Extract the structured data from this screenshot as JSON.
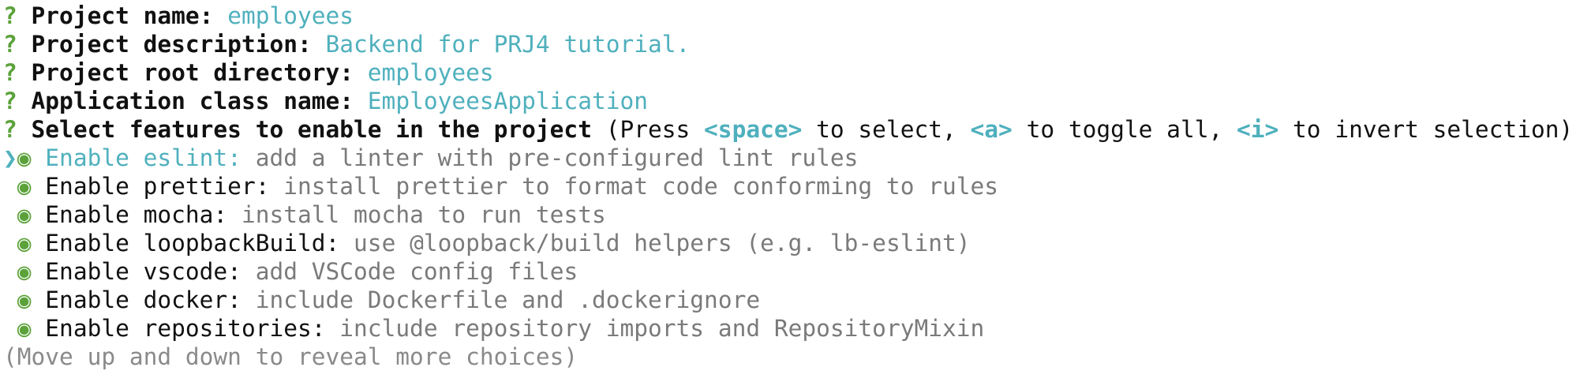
{
  "prompts": [
    {
      "mark": "?",
      "label": "Project name:",
      "answer": "employees"
    },
    {
      "mark": "?",
      "label": "Project description:",
      "answer": "Backend for PRJ4 tutorial."
    },
    {
      "mark": "?",
      "label": "Project root directory:",
      "answer": "employees"
    },
    {
      "mark": "?",
      "label": "Application class name:",
      "answer": "EmployeesApplication"
    }
  ],
  "select": {
    "mark": "?",
    "label": "Select features to enable in the project",
    "hint_open": "(Press ",
    "key_space": "<space>",
    "hint_select": " to select, ",
    "key_a": "<a>",
    "hint_toggle": " to toggle all, ",
    "key_i": "<i>",
    "hint_invert": " to invert selection)"
  },
  "pointer": "❯",
  "bullet": "◉",
  "options": [
    {
      "name": "Enable eslint:",
      "desc": "add a linter with pre-configured lint rules"
    },
    {
      "name": "Enable prettier:",
      "desc": "install prettier to format code conforming to rules"
    },
    {
      "name": "Enable mocha:",
      "desc": "install mocha to run tests"
    },
    {
      "name": "Enable loopbackBuild:",
      "desc": "use @loopback/build helpers (e.g. lb-eslint)"
    },
    {
      "name": "Enable vscode:",
      "desc": "add VSCode config files"
    },
    {
      "name": "Enable docker:",
      "desc": "include Dockerfile and .dockerignore"
    },
    {
      "name": "Enable repositories:",
      "desc": "include repository imports and RepositoryMixin"
    }
  ],
  "footer": "(Move up and down to reveal more choices)",
  "colors": {
    "prompt_mark": "#5ba23a",
    "answer": "#4fb0bd",
    "description": "#7a7a7a"
  }
}
